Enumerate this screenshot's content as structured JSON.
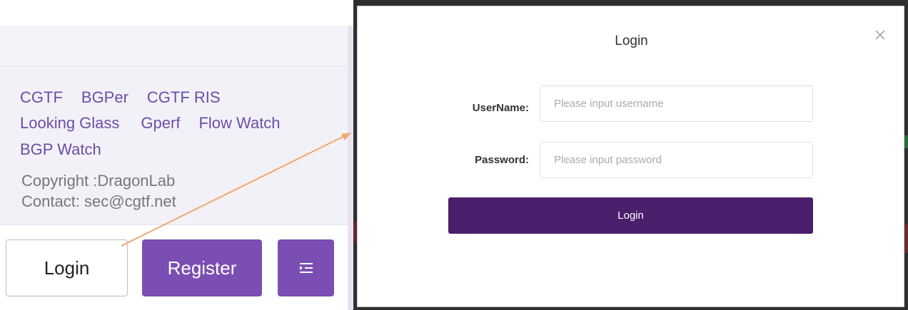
{
  "sidebar": {
    "links_row1": [
      "CGTF",
      "BGPer",
      "CGTF RIS"
    ],
    "links_row2": [
      "Looking Glass",
      "Gperf",
      "Flow Watch"
    ],
    "links_row3": [
      "BGP Watch"
    ],
    "copyright": "Copyright :DragonLab",
    "contact": "Contact: sec@cgtf.net",
    "login_label": "Login",
    "register_label": "Register",
    "menu_icon": "menu-fold-icon"
  },
  "dialog": {
    "title": "Login",
    "close_icon": "close-icon",
    "username_label": "UserName:",
    "username_placeholder": "Please input username",
    "username_value": "",
    "password_label": "Password:",
    "password_placeholder": "Please input password",
    "password_value": "",
    "submit_label": "Login"
  },
  "colors": {
    "accent": "#7a4eb2",
    "submit": "#4a1f6b",
    "link": "#6a4ea8",
    "annotation_arrow": "#f0a870"
  }
}
